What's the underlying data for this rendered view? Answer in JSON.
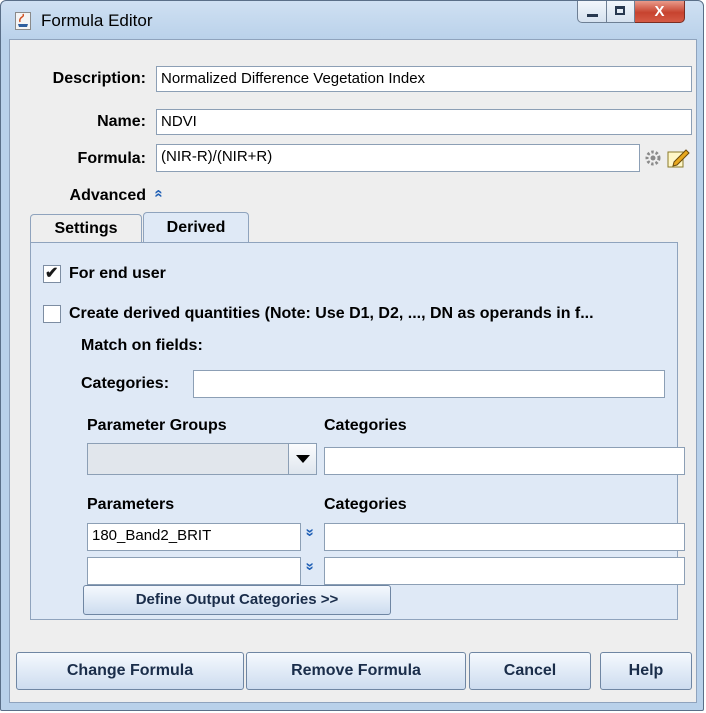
{
  "window": {
    "title": "Formula Editor"
  },
  "form": {
    "description_label": "Description:",
    "description_value": "Normalized Difference Vegetation Index",
    "name_label": "Name:",
    "name_value": "NDVI",
    "formula_label": "Formula:",
    "formula_value": "(NIR-R)/(NIR+R)",
    "advanced_label": "Advanced",
    "advanced_chevron": "«"
  },
  "tabs": [
    {
      "label": "Settings",
      "active": false
    },
    {
      "label": "Derived",
      "active": true
    }
  ],
  "derived": {
    "for_end_user_label": "For end user",
    "for_end_user_checked": true,
    "create_derived_label": "Create derived quantities (Note: Use D1, D2, ..., DN as operands in f...",
    "create_derived_checked": false,
    "match_on_fields_label": "Match on fields:",
    "categories_label": "Categories:",
    "categories_value": "",
    "parameter_groups_header": "Parameter Groups",
    "categories_header_1": "Categories",
    "parameter_group_value": "",
    "parameter_group_categories_value": "",
    "parameters_header": "Parameters",
    "categories_header_2": "Categories",
    "parameters": [
      {
        "value": "180_Band2_BRIT",
        "categories": ""
      },
      {
        "value": "",
        "categories": ""
      }
    ],
    "define_output_button": "Define Output Categories >>"
  },
  "buttons": {
    "change": "Change Formula",
    "remove": "Remove Formula",
    "cancel": "Cancel",
    "help": "Help"
  }
}
